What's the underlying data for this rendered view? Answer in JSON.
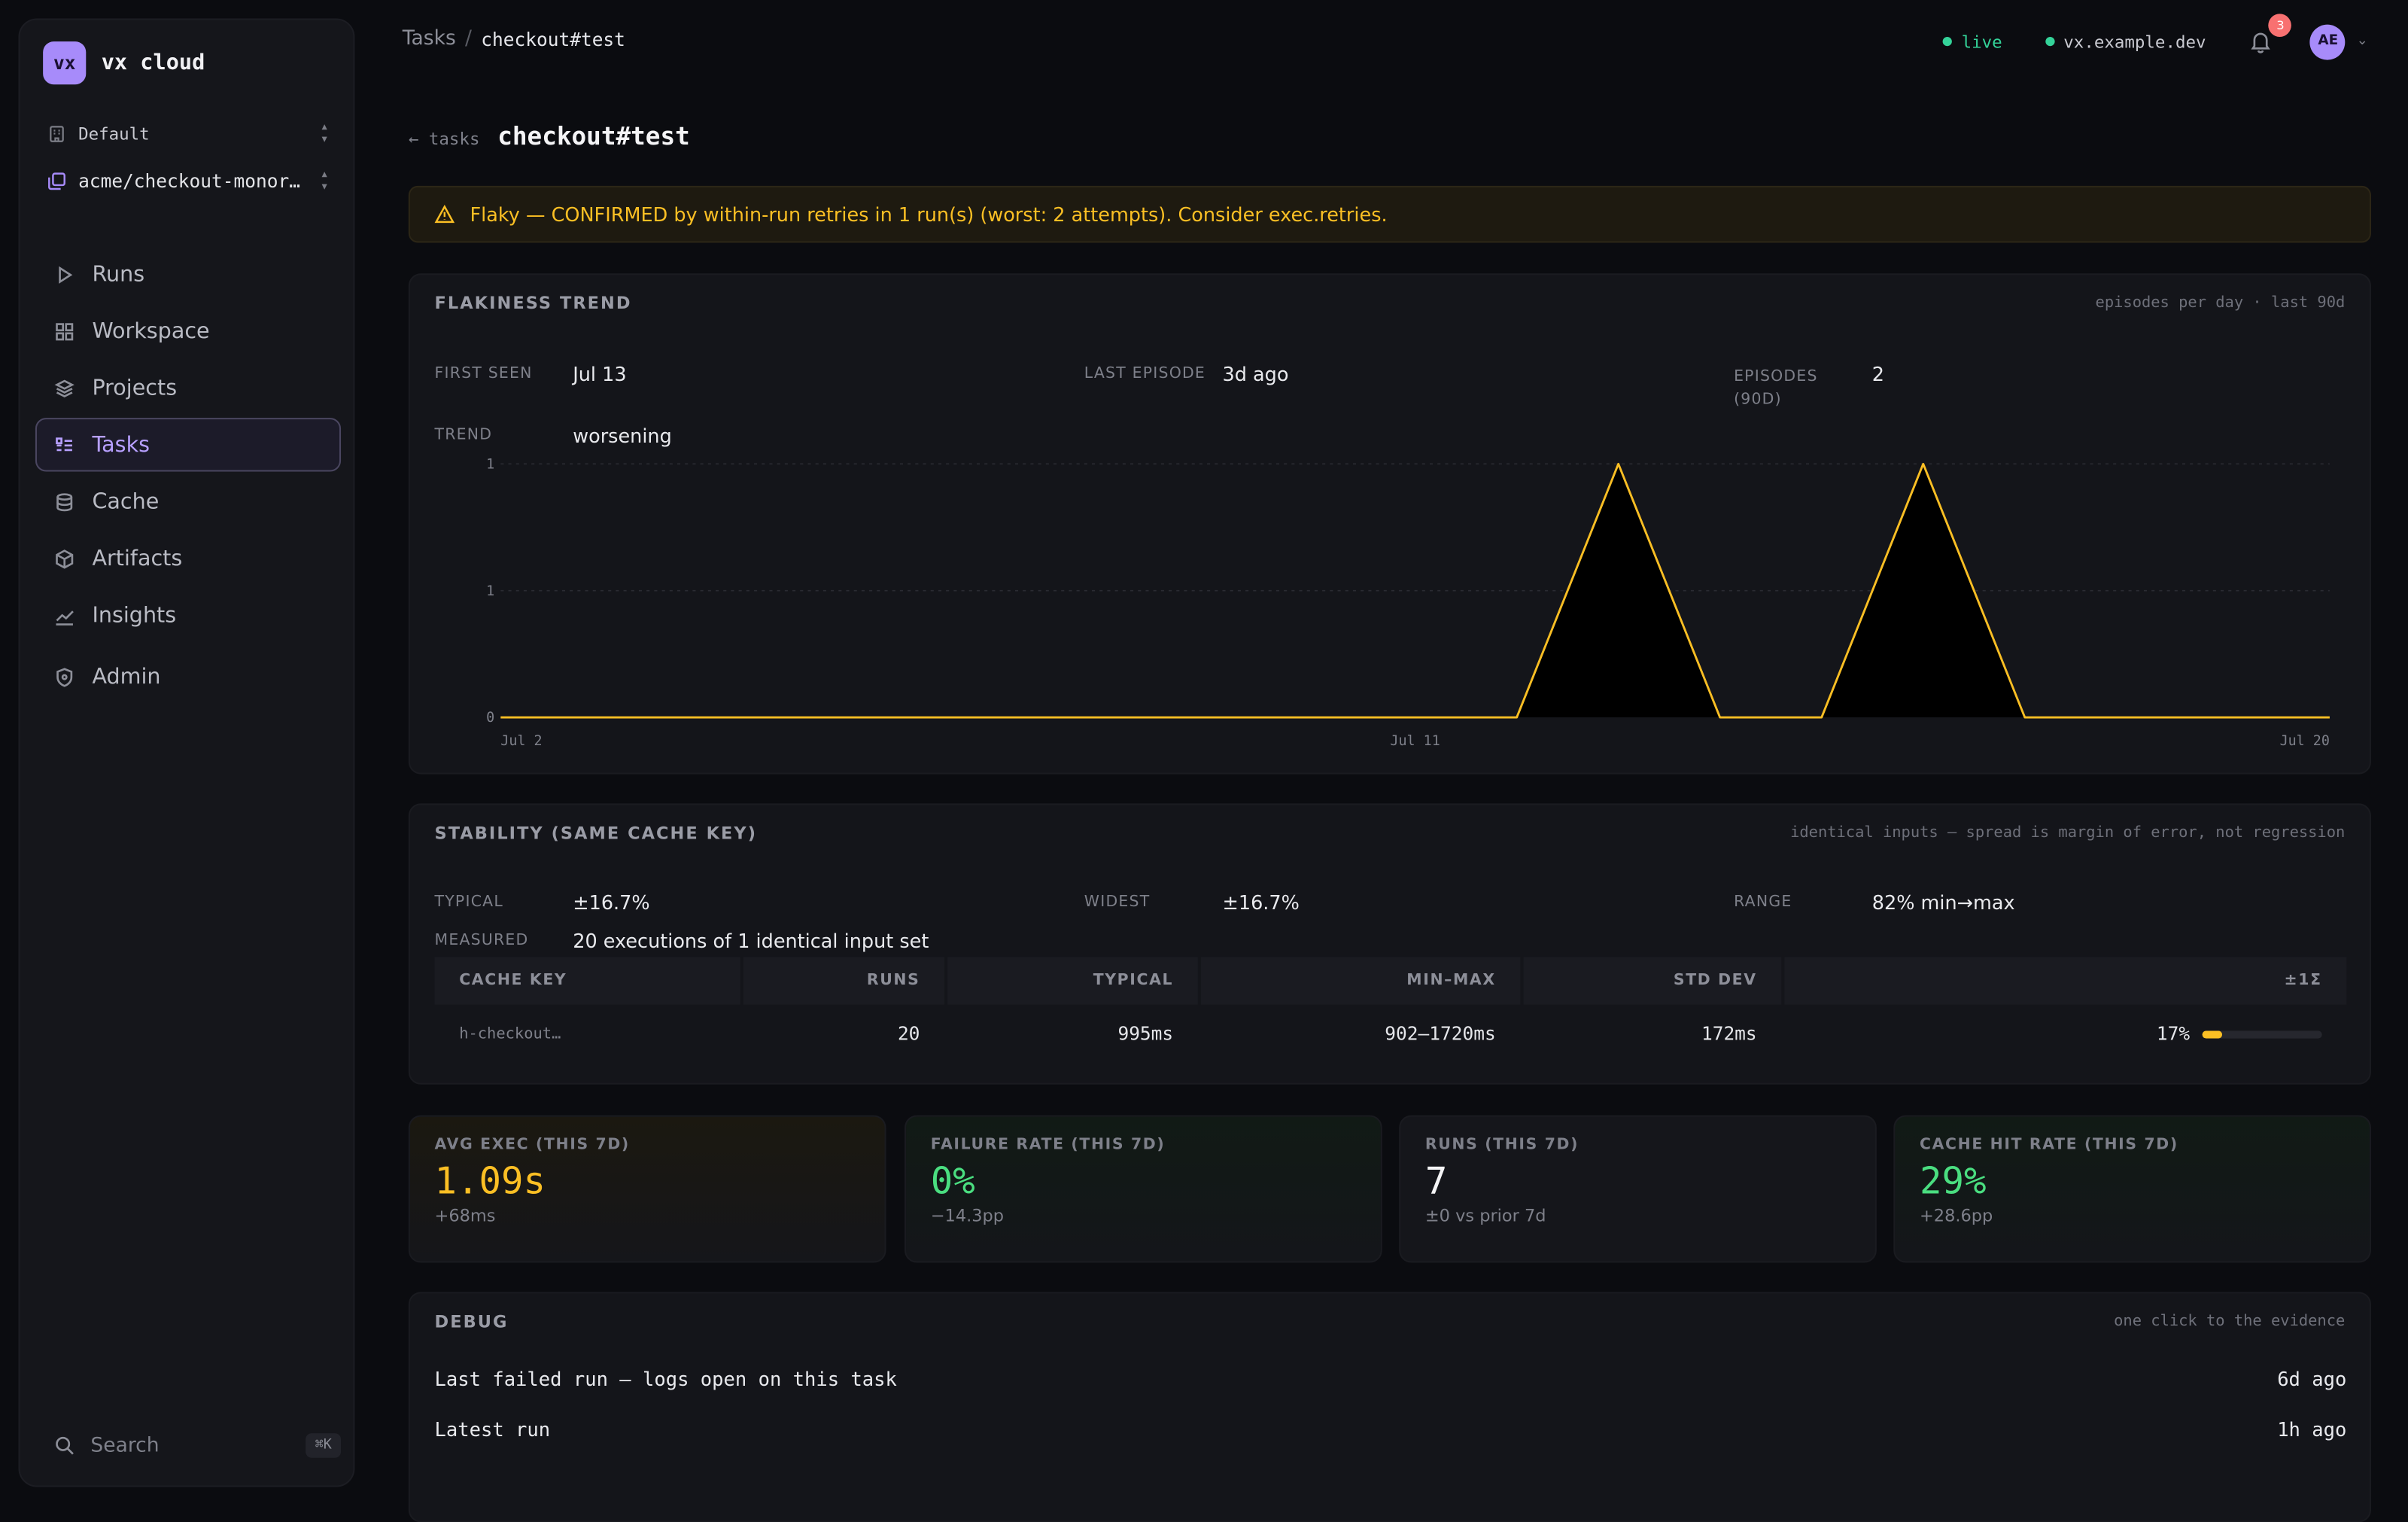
{
  "app": {
    "logo": "vx",
    "name": "vx cloud"
  },
  "org": {
    "workspace": "Default",
    "repo": "acme/checkout-monor…"
  },
  "nav": [
    {
      "label": "Runs",
      "icon": "play-icon"
    },
    {
      "label": "Workspace",
      "icon": "grid-icon"
    },
    {
      "label": "Projects",
      "icon": "layers-icon"
    },
    {
      "label": "Tasks",
      "icon": "list-icon",
      "active": true
    },
    {
      "label": "Cache",
      "icon": "database-icon"
    },
    {
      "label": "Artifacts",
      "icon": "package-icon"
    },
    {
      "label": "Insights",
      "icon": "chart-icon"
    },
    {
      "label": "Admin",
      "icon": "shield-icon"
    }
  ],
  "search": {
    "label": "Search",
    "shortcut": "⌘K"
  },
  "header": {
    "breadcrumb_root": "Tasks",
    "breadcrumb_sep": "/",
    "breadcrumb_current": "checkout#test",
    "status_live": "live",
    "host": "vx.example.dev",
    "notifications": "3",
    "avatar": "AE"
  },
  "page": {
    "back": "← tasks",
    "title": "checkout#test"
  },
  "alert": {
    "text": "Flaky — CONFIRMED by within-run retries in 1 run(s) (worst: 2 attempts). Consider exec.retries."
  },
  "trend": {
    "title": "FLAKINESS TREND",
    "note": "episodes per day · last 90d",
    "first_seen_label": "FIRST SEEN",
    "first_seen": "Jul 13",
    "last_episode_label": "LAST EPISODE",
    "last_episode": "3d ago",
    "episodes_label": "EPISODES (90D)",
    "episodes": "2",
    "trend_label": "TREND",
    "trend": "worsening"
  },
  "chart_data": {
    "type": "area",
    "x": [
      "Jul 2",
      "Jul 3",
      "Jul 4",
      "Jul 5",
      "Jul 6",
      "Jul 7",
      "Jul 8",
      "Jul 9",
      "Jul 10",
      "Jul 11",
      "Jul 12",
      "Jul 13",
      "Jul 14",
      "Jul 15",
      "Jul 16",
      "Jul 17",
      "Jul 18",
      "Jul 19",
      "Jul 20"
    ],
    "values": [
      0,
      0,
      0,
      0,
      0,
      0,
      0,
      0,
      0,
      0,
      0,
      1,
      0,
      0,
      1,
      0,
      0,
      0,
      0
    ],
    "tick_labels": [
      "Jul 2",
      "Jul 11",
      "Jul 20"
    ],
    "y_tick_labels": [
      "0",
      "1",
      "1"
    ],
    "ylim": [
      0,
      1
    ],
    "grid": true,
    "line_color": "#fbbf24"
  },
  "stability": {
    "title": "STABILITY (SAME CACHE KEY)",
    "note": "identical inputs — spread is margin of error, not regression",
    "typical_label": "TYPICAL",
    "typical": "±16.7%",
    "widest_label": "WIDEST",
    "widest": "±16.7%",
    "range_label": "RANGE",
    "range": "82% min→max",
    "measured_label": "MEASURED",
    "measured": "20 executions of 1 identical input set",
    "columns": [
      "CACHE KEY",
      "RUNS",
      "TYPICAL",
      "MIN–MAX",
      "STD DEV",
      "±1Σ"
    ],
    "rows": [
      {
        "key": "h-checkout…",
        "runs": "20",
        "typical": "995ms",
        "minmax": "902–1720ms",
        "std": "172ms",
        "spread": "17%",
        "spread_fraction": 0.17
      }
    ]
  },
  "kpis": [
    {
      "label": "AVG EXEC (THIS 7D)",
      "value": "1.09s",
      "sub": "+68ms",
      "color": "#fbbf24"
    },
    {
      "label": "FAILURE RATE (THIS 7D)",
      "value": "0%",
      "sub": "−14.3pp",
      "color": "#4ade80"
    },
    {
      "label": "RUNS (THIS 7D)",
      "value": "7",
      "sub": "±0 vs prior 7d",
      "color": "#f4f4f6"
    },
    {
      "label": "CACHE HIT RATE (THIS 7D)",
      "value": "29%",
      "sub": "+28.6pp",
      "color": "#4ade80"
    }
  ],
  "debug": {
    "title": "DEBUG",
    "note": "one click to the evidence",
    "rows": [
      {
        "label": "Last failed run — logs open on this task",
        "time": "6d ago"
      },
      {
        "label": "Latest run",
        "time": "1h ago"
      }
    ]
  }
}
